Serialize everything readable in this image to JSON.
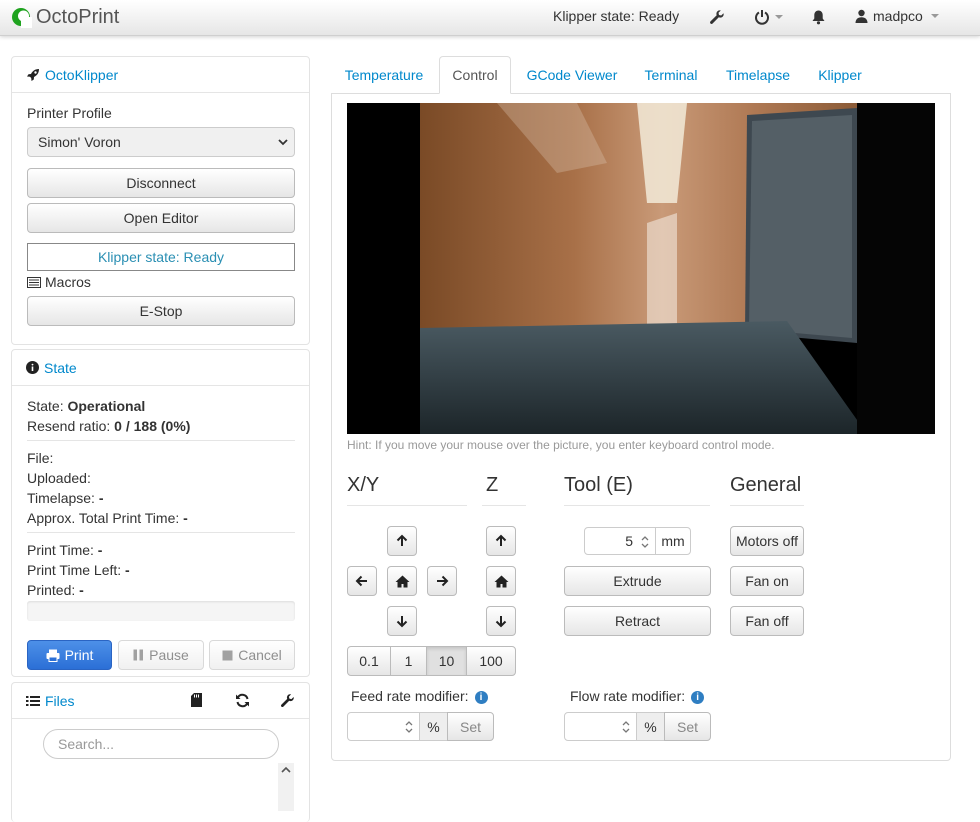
{
  "app": {
    "brand": "OctoPrint"
  },
  "navbar": {
    "status": "Klipper state: Ready",
    "user": "madpco",
    "icons": [
      "wrench-icon",
      "power-icon",
      "bell-icon",
      "user-icon"
    ]
  },
  "octoklipper": {
    "title": "OctoKlipper",
    "profile_label": "Printer Profile",
    "profile_value": "Simon' Voron",
    "disconnect": "Disconnect",
    "open_editor": "Open Editor",
    "state_box": "Klipper state: Ready",
    "macros": "Macros",
    "estop": "E-Stop"
  },
  "state": {
    "title": "State",
    "state_label": "State:",
    "state_value": "Operational",
    "resend_label": "Resend ratio:",
    "resend_value": "0 / 188 (0%)",
    "file_label": "File:",
    "uploaded_label": "Uploaded:",
    "timelapse_label": "Timelapse:",
    "timelapse_value": "-",
    "approx_label": "Approx. Total Print Time:",
    "approx_value": "-",
    "print_time_label": "Print Time:",
    "print_time_value": "-",
    "time_left_label": "Print Time Left:",
    "time_left_value": "-",
    "printed_label": "Printed:",
    "printed_value": "-",
    "progress": 0,
    "print": "Print",
    "pause": "Pause",
    "cancel": "Cancel"
  },
  "files": {
    "title": "Files",
    "search_placeholder": "Search..."
  },
  "tabs": [
    {
      "label": "Temperature"
    },
    {
      "label": "Control"
    },
    {
      "label": "GCode Viewer"
    },
    {
      "label": "Terminal"
    },
    {
      "label": "Timelapse"
    },
    {
      "label": "Klipper"
    }
  ],
  "active_tab": "Control",
  "control": {
    "hint": "Hint: If you move your mouse over the picture, you enter keyboard control mode.",
    "xy_title": "X/Y",
    "z_title": "Z",
    "tool_title": "Tool (E)",
    "general_title": "General",
    "steps": [
      "0.1",
      "1",
      "10",
      "100"
    ],
    "active_step": "10",
    "extrude_amount": "5",
    "extrude_unit": "mm",
    "extrude": "Extrude",
    "retract": "Retract",
    "motors_off": "Motors off",
    "fan_on": "Fan on",
    "fan_off": "Fan off",
    "feed_label": "Feed rate modifier:",
    "flow_label": "Flow rate modifier:",
    "percent": "%",
    "set": "Set"
  },
  "colors": {
    "link": "#0088cc",
    "primary": "#2b6fd6"
  }
}
